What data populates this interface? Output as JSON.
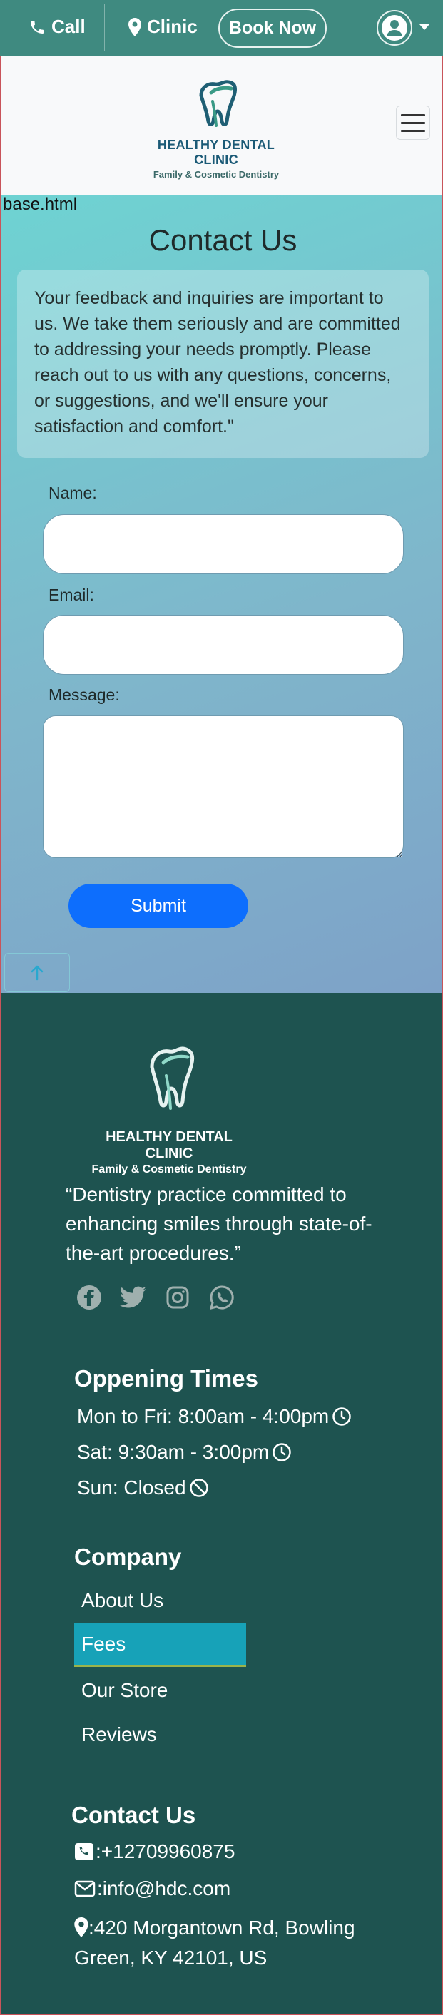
{
  "topbar": {
    "call_label": "Call",
    "clinic_label": "Clinic",
    "book_label": "Book Now"
  },
  "brand": {
    "name": "HEALTHY DENTAL CLINIC",
    "subtitle": "Family & Cosmetic Dentistry"
  },
  "contact": {
    "base_label": "base.html",
    "title": "Contact Us",
    "intro": "Your feedback and inquiries are important to us. We take them seriously and are committed to addressing your needs promptly. Please reach out to us with any questions, concerns, or suggestions, and we'll ensure your satisfaction and comfort.\"",
    "form": {
      "name_label": "Name:",
      "email_label": "Email:",
      "message_label": "Message:",
      "name_value": "",
      "email_value": "",
      "message_value": "",
      "submit_label": "Submit"
    },
    "backtop_icon": "arrow-up-icon"
  },
  "footer": {
    "tagline": "“Dentistry practice committed to enhancing smiles through state-of-the-art procedures.”",
    "socials": [
      "facebook-icon",
      "twitter-icon",
      "instagram-icon",
      "whatsapp-icon"
    ],
    "hours": {
      "heading": "Oppening Times",
      "rows": [
        {
          "text": "Mon to Fri: 8:00am - 4:00pm",
          "icon": "clock-icon"
        },
        {
          "text": "Sat: 9:30am - 3:00pm",
          "icon": "clock-icon"
        },
        {
          "text": "Sun: Closed",
          "icon": "ban-icon"
        }
      ]
    },
    "company": {
      "heading": "Company",
      "items": [
        {
          "label": "About Us",
          "active": false
        },
        {
          "label": "Fees",
          "active": true
        },
        {
          "label": "Our Store",
          "active": false
        },
        {
          "label": "Reviews",
          "active": false
        }
      ]
    },
    "contact": {
      "heading": "Contact Us",
      "phone": ":+12709960875",
      "email": ":info@hdc.com",
      "address": ":420 Morgantown Rd, Bowling Green, KY 42101, US"
    }
  },
  "colors": {
    "topbar": "#3f8a80",
    "footer": "#1e5350",
    "accent": "#0d6efd",
    "active_item": "#17a2b8"
  }
}
